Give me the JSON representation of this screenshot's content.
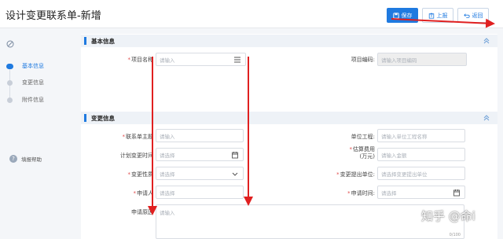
{
  "header": {
    "title": "设计变更联系单-新增",
    "save_label": "保存",
    "report_label": "上报",
    "back_label": "返回"
  },
  "sidebar": {
    "steps": [
      {
        "label": "基本信息",
        "active": true
      },
      {
        "label": "变更信息",
        "active": false
      },
      {
        "label": "附件信息",
        "active": false
      }
    ],
    "help_label": "填报帮助"
  },
  "sections": {
    "basic": {
      "title": "基本信息",
      "project_name": {
        "label": "项目名称",
        "placeholder": "请输入"
      },
      "project_code": {
        "label": "项目编码:",
        "placeholder": "请输入项目编码"
      }
    },
    "change": {
      "title": "变更信息",
      "contact_subject": {
        "label": "联系单主题",
        "placeholder": "请输入"
      },
      "unit_project": {
        "label": "单位工程:",
        "placeholder": "请输入单位工程名称"
      },
      "planned_time": {
        "label": "计划变更时间",
        "placeholder": "请选择"
      },
      "estimated_cost": {
        "label_line1": "估算费用",
        "label_line2": "(万元)",
        "placeholder": "请输入金额"
      },
      "change_nature": {
        "label": "变更性质",
        "placeholder": "请选择"
      },
      "proposing_unit": {
        "label": "变更提出单位:",
        "placeholder": "请选择变更提出单位"
      },
      "applicant": {
        "label": "申请人",
        "placeholder": "请选择"
      },
      "apply_time": {
        "label": "申请时间:",
        "placeholder": "请选择"
      },
      "reason": {
        "label": "申请原因",
        "placeholder": "请输入",
        "counter": "0/100"
      }
    }
  },
  "watermark": "知乎 @命i",
  "colors": {
    "accent": "#1f7ae0",
    "annotation": "#e02020"
  }
}
